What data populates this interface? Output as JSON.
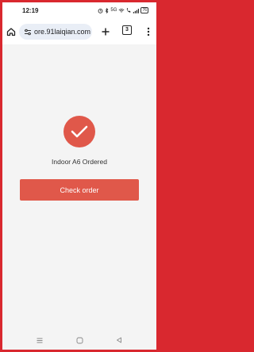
{
  "status_bar": {
    "time": "12:19",
    "network_text": "5G",
    "battery": "76"
  },
  "browser": {
    "url": "ore.91laiqian.com",
    "tab_count": "3",
    "icons": [
      "home-icon",
      "site-settings-icon",
      "new-tab-plus-icon",
      "tab-switcher-icon",
      "more-menu-icon"
    ]
  },
  "page": {
    "success_message": "Indoor A6 Ordered",
    "check_order_label": "Check order"
  },
  "colors": {
    "accent": "#e0584a",
    "background": "#f4f4f4",
    "frame": "#d9282f"
  },
  "system_nav": {
    "icons": [
      "recents-icon",
      "home-circle-icon",
      "back-triangle-icon"
    ]
  }
}
